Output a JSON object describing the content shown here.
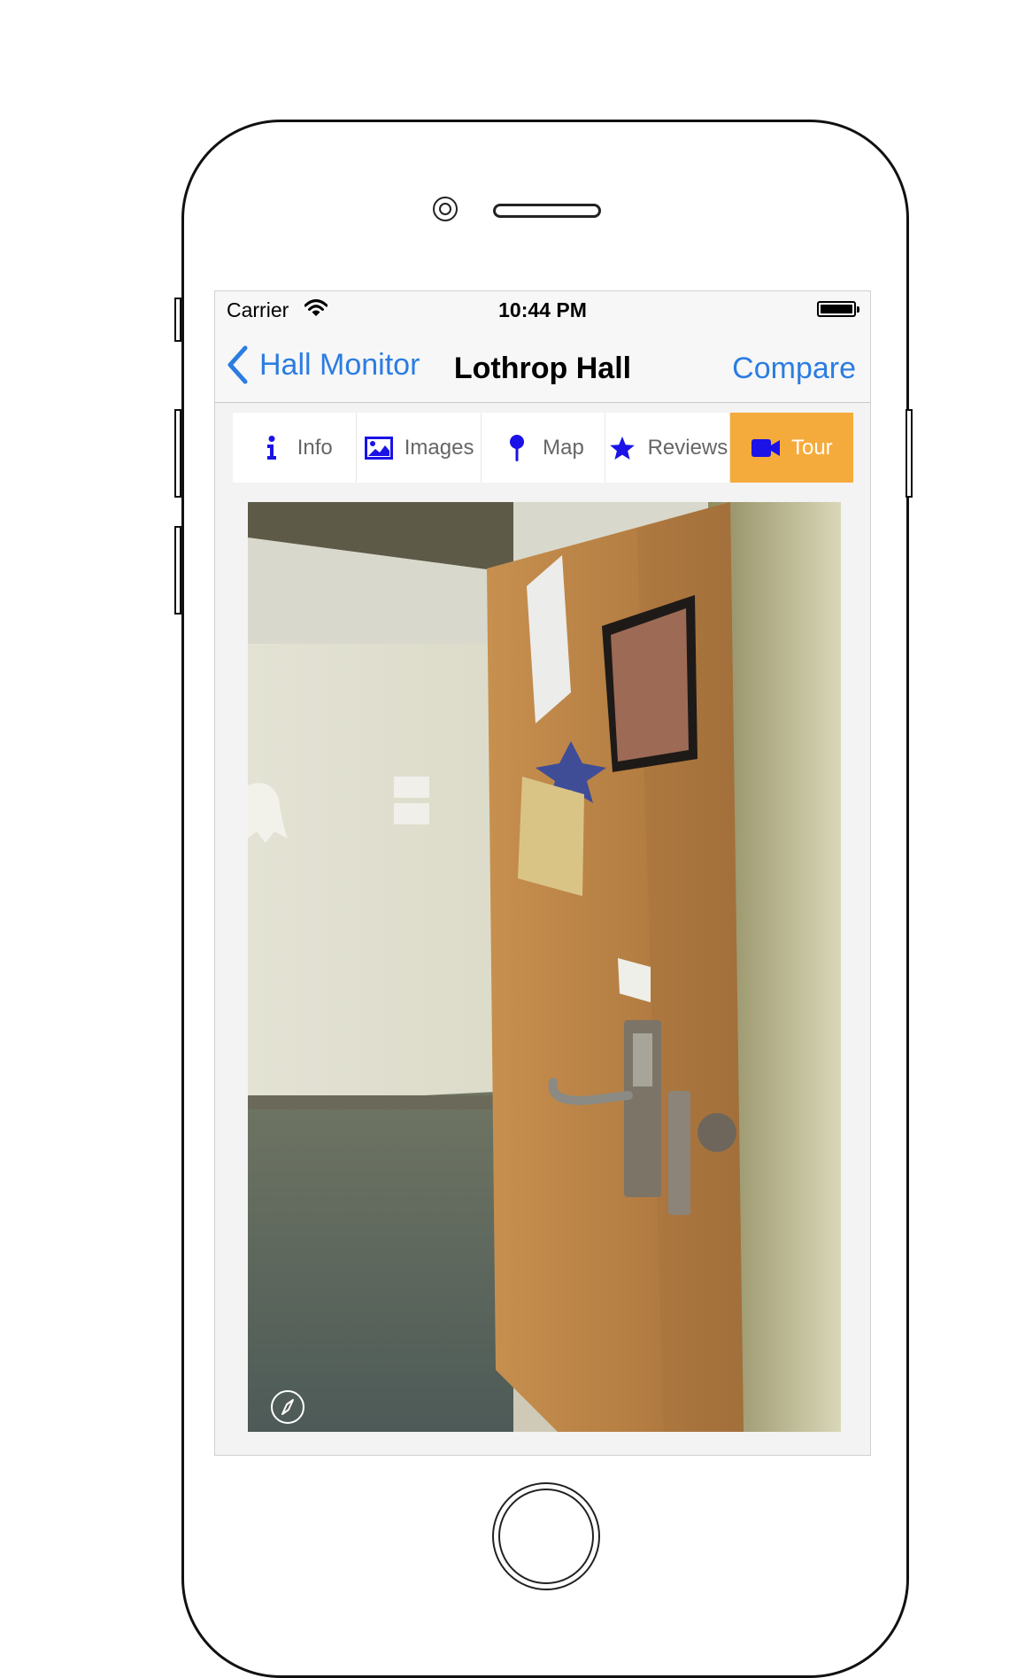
{
  "status_bar": {
    "carrier": "Carrier",
    "time": "10:44 PM"
  },
  "nav_bar": {
    "back_label": "Hall Monitor",
    "title": "Lothrop Hall",
    "right_button": "Compare"
  },
  "tabs": [
    {
      "label": "Info",
      "icon": "info-icon",
      "active": false
    },
    {
      "label": "Images",
      "icon": "image-icon",
      "active": false
    },
    {
      "label": "Map",
      "icon": "map-pin-icon",
      "active": false
    },
    {
      "label": "Reviews",
      "icon": "star-icon",
      "active": false
    },
    {
      "label": "Tour",
      "icon": "video-camera-icon",
      "active": true
    }
  ],
  "colors": {
    "tint": "#2b7de1",
    "active_tab": "#f5ab3c",
    "tab_icon": "#1a12e6"
  },
  "tour": {
    "content": "360 panorama photo of a dorm room doorway",
    "compass_icon": "compass-icon"
  }
}
